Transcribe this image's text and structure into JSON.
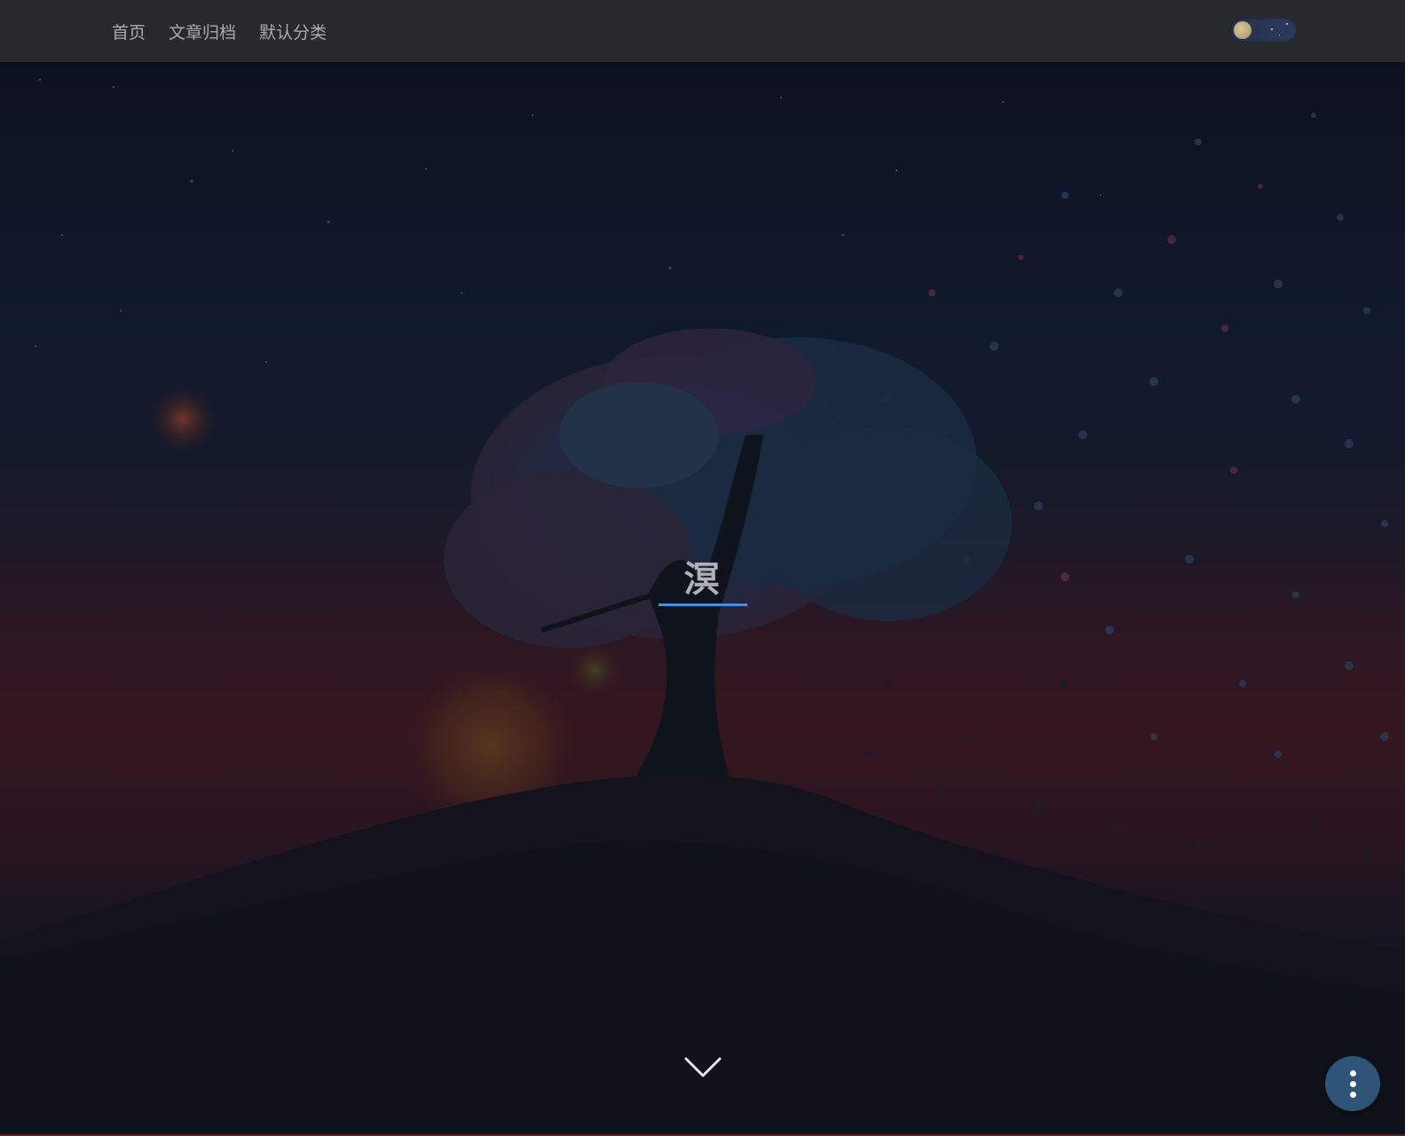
{
  "nav": {
    "items": [
      {
        "label": "首页"
      },
      {
        "label": "文章归档"
      },
      {
        "label": "默认分类"
      }
    ],
    "theme_toggle": {
      "mode": "dark",
      "icon": "moon-icon"
    }
  },
  "hero": {
    "title": "溟",
    "accent_color": "#4d8ed8",
    "scroll_icon": "chevron-down-icon"
  },
  "fab": {
    "icon": "more-vertical-icon",
    "color": "#2e5478"
  }
}
